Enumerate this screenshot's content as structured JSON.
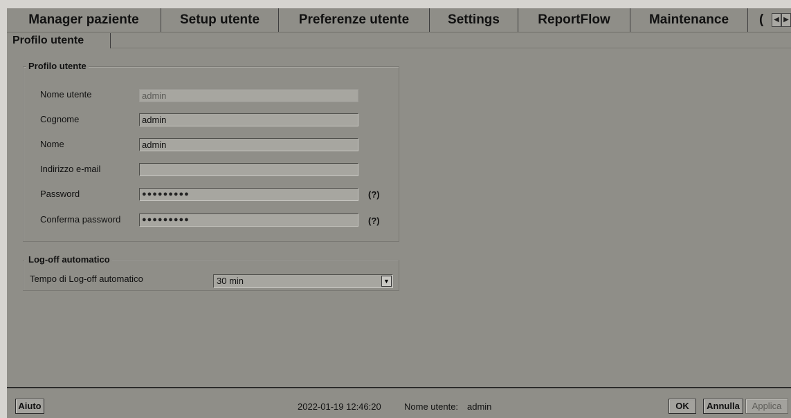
{
  "tabs": [
    {
      "label": "Manager paziente"
    },
    {
      "label": "Setup utente"
    },
    {
      "label": "Preferenze utente"
    },
    {
      "label": "Settings"
    },
    {
      "label": "ReportFlow"
    },
    {
      "label": "Maintenance"
    }
  ],
  "tabs_overflow": "(",
  "subtab": {
    "label": "Profilo utente"
  },
  "profile": {
    "legend": "Profilo utente",
    "username_label": "Nome utente",
    "username_value": "admin",
    "surname_label": "Cognome",
    "surname_value": "admin",
    "name_label": "Nome",
    "name_value": "admin",
    "email_label": "Indirizzo e-mail",
    "email_value": "",
    "password_label": "Password",
    "password_value": "●●●●●●●●●",
    "confirm_label": "Conferma password",
    "confirm_value": "●●●●●●●●●",
    "help_text": "(?)"
  },
  "logoff": {
    "legend": "Log-off automatico",
    "time_label": "Tempo di Log-off automatico",
    "time_value": "30 min"
  },
  "footer": {
    "help_button": "Aiuto",
    "datetime": "2022-01-19  12:46:20",
    "user_label": "Nome utente:",
    "user_value": "admin",
    "ok_button": "OK",
    "cancel_button": "Annulla",
    "apply_button": "Applica"
  }
}
